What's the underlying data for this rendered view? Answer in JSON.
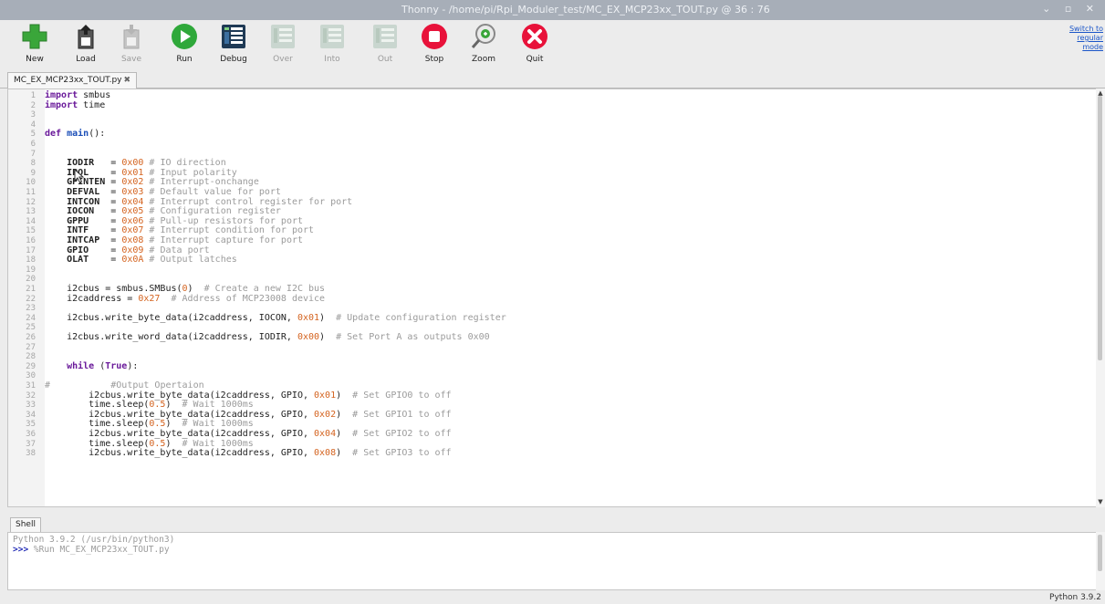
{
  "window": {
    "title": "Thonny  -  /home/pi/Rpi_Moduler_test/MC_EX_MCP23xx_TOUT.py  @  36 : 76",
    "controls": "⌄ ▫ ✕"
  },
  "toolbar": {
    "buttons": [
      {
        "label": "New",
        "icon": "new-icon",
        "enabled": true
      },
      {
        "label": "Load",
        "icon": "load-icon",
        "enabled": true
      },
      {
        "label": "Save",
        "icon": "save-icon",
        "enabled": false
      },
      {
        "label": "Run",
        "icon": "run-icon",
        "enabled": true
      },
      {
        "label": "Debug",
        "icon": "debug-icon",
        "enabled": true
      },
      {
        "label": "Over",
        "icon": "step-over-icon",
        "enabled": false
      },
      {
        "label": "Into",
        "icon": "step-into-icon",
        "enabled": false
      },
      {
        "label": "Out",
        "icon": "step-out-icon",
        "enabled": false
      },
      {
        "label": "Stop",
        "icon": "stop-icon",
        "enabled": true
      },
      {
        "label": "Zoom",
        "icon": "zoom-icon",
        "enabled": true
      },
      {
        "label": "Quit",
        "icon": "quit-icon",
        "enabled": true
      }
    ],
    "switch_mode": {
      "line1": "Switch to",
      "line2": "regular",
      "line3": "mode"
    }
  },
  "editor": {
    "tab_label": "MC_EX_MCP23xx_TOUT.py",
    "tab_close": "✖",
    "line_numbers": [
      "1",
      "2",
      "3",
      "4",
      "5",
      "6",
      "7",
      "8",
      "9",
      "10",
      "11",
      "12",
      "13",
      "14",
      "15",
      "16",
      "17",
      "18",
      "19",
      "20",
      "21",
      "22",
      "23",
      "24",
      "25",
      "26",
      "27",
      "28",
      "29",
      "30",
      "31",
      "32",
      "33",
      "34",
      "35",
      "36",
      "37",
      "38"
    ],
    "lines": [
      [
        [
          "kw",
          "import"
        ],
        [
          "p",
          " smbus"
        ]
      ],
      [
        [
          "kw",
          "import"
        ],
        [
          "p",
          " time"
        ]
      ],
      [],
      [],
      [
        [
          "kw",
          "def"
        ],
        [
          "p",
          " "
        ],
        [
          "fn",
          "main"
        ],
        [
          "p",
          "():"
        ]
      ],
      [],
      [],
      [
        [
          "p",
          "    "
        ],
        [
          "bd",
          "IODIR"
        ],
        [
          "p",
          "   = "
        ],
        [
          "nm",
          "0x00"
        ],
        [
          "cm",
          " # IO direction"
        ]
      ],
      [
        [
          "p",
          "    "
        ],
        [
          "bd",
          "IPOL"
        ],
        [
          "p",
          "    = "
        ],
        [
          "nm",
          "0x01"
        ],
        [
          "cm",
          " # Input polarity"
        ]
      ],
      [
        [
          "p",
          "    "
        ],
        [
          "bd",
          "GPINTEN"
        ],
        [
          "p",
          " = "
        ],
        [
          "nm",
          "0x02"
        ],
        [
          "cm",
          " # Interrupt-onchange"
        ]
      ],
      [
        [
          "p",
          "    "
        ],
        [
          "bd",
          "DEFVAL"
        ],
        [
          "p",
          "  = "
        ],
        [
          "nm",
          "0x03"
        ],
        [
          "cm",
          " # Default value for port"
        ]
      ],
      [
        [
          "p",
          "    "
        ],
        [
          "bd",
          "INTCON"
        ],
        [
          "p",
          "  = "
        ],
        [
          "nm",
          "0x04"
        ],
        [
          "cm",
          " # Interrupt control register for port"
        ]
      ],
      [
        [
          "p",
          "    "
        ],
        [
          "bd",
          "IOCON"
        ],
        [
          "p",
          "   = "
        ],
        [
          "nm",
          "0x05"
        ],
        [
          "cm",
          " # Configuration register"
        ]
      ],
      [
        [
          "p",
          "    "
        ],
        [
          "bd",
          "GPPU"
        ],
        [
          "p",
          "    = "
        ],
        [
          "nm",
          "0x06"
        ],
        [
          "cm",
          " # Pull-up resistors for port"
        ]
      ],
      [
        [
          "p",
          "    "
        ],
        [
          "bd",
          "INTF"
        ],
        [
          "p",
          "    = "
        ],
        [
          "nm",
          "0x07"
        ],
        [
          "cm",
          " # Interrupt condition for port"
        ]
      ],
      [
        [
          "p",
          "    "
        ],
        [
          "bd",
          "INTCAP"
        ],
        [
          "p",
          "  = "
        ],
        [
          "nm",
          "0x08"
        ],
        [
          "cm",
          " # Interrupt capture for port"
        ]
      ],
      [
        [
          "p",
          "    "
        ],
        [
          "bd",
          "GPIO"
        ],
        [
          "p",
          "    = "
        ],
        [
          "nm",
          "0x09"
        ],
        [
          "cm",
          " # Data port"
        ]
      ],
      [
        [
          "p",
          "    "
        ],
        [
          "bd",
          "OLAT"
        ],
        [
          "p",
          "    = "
        ],
        [
          "nm",
          "0x0A"
        ],
        [
          "cm",
          " # Output latches"
        ]
      ],
      [],
      [],
      [
        [
          "p",
          "    i2cbus = smbus.SMBus("
        ],
        [
          "nm",
          "0"
        ],
        [
          "p",
          ")  "
        ],
        [
          "cm",
          "# Create a new I2C bus"
        ]
      ],
      [
        [
          "p",
          "    i2caddress = "
        ],
        [
          "nm",
          "0x27"
        ],
        [
          "p",
          "  "
        ],
        [
          "cm",
          "# Address of MCP23008 device"
        ]
      ],
      [],
      [
        [
          "p",
          "    i2cbus.write_byte_data(i2caddress, IOCON, "
        ],
        [
          "nm",
          "0x01"
        ],
        [
          "p",
          ")  "
        ],
        [
          "cm",
          "# Update configuration register"
        ]
      ],
      [],
      [
        [
          "p",
          "    i2cbus.write_word_data(i2caddress, IODIR, "
        ],
        [
          "nm",
          "0x00"
        ],
        [
          "p",
          ")  "
        ],
        [
          "cm",
          "# Set Port A as outputs 0x00"
        ]
      ],
      [],
      [],
      [
        [
          "p",
          "    "
        ],
        [
          "kw",
          "while"
        ],
        [
          "p",
          " ("
        ],
        [
          "kw",
          "True"
        ],
        [
          "p",
          "):"
        ]
      ],
      [],
      [
        [
          "cm",
          "#"
        ],
        [
          "p",
          "           "
        ],
        [
          "cm",
          "#Output Opertaion"
        ]
      ],
      [
        [
          "p",
          "        i2cbus.write_byte_data(i2caddress, GPIO, "
        ],
        [
          "nm",
          "0x01"
        ],
        [
          "p",
          ")  "
        ],
        [
          "cm",
          "# Set GPIO0 to off"
        ]
      ],
      [
        [
          "p",
          "        time.sleep("
        ],
        [
          "nm",
          "0.5"
        ],
        [
          "p",
          ")  "
        ],
        [
          "cm",
          "# Wait 1000ms"
        ]
      ],
      [
        [
          "p",
          "        i2cbus.write_byte_data(i2caddress, GPIO, "
        ],
        [
          "nm",
          "0x02"
        ],
        [
          "p",
          ")  "
        ],
        [
          "cm",
          "# Set GPIO1 to off"
        ]
      ],
      [
        [
          "p",
          "        time.sleep("
        ],
        [
          "nm",
          "0.5"
        ],
        [
          "p",
          ")  "
        ],
        [
          "cm",
          "# Wait 1000ms"
        ]
      ],
      [
        [
          "p",
          "        i2cbus.write_byte_data(i2caddress, GPIO, "
        ],
        [
          "nm",
          "0x04"
        ],
        [
          "p",
          ")  "
        ],
        [
          "cm",
          "# Set GPIO2 to off"
        ]
      ],
      [
        [
          "p",
          "        time.sleep("
        ],
        [
          "nm",
          "0.5"
        ],
        [
          "p",
          ")  "
        ],
        [
          "cm",
          "# Wait 1000ms"
        ]
      ],
      [
        [
          "p",
          "        i2cbus.write_byte_data(i2caddress, GPIO, "
        ],
        [
          "nm",
          "0x08"
        ],
        [
          "p",
          ")  "
        ],
        [
          "cm",
          "# Set GPIO3 to off"
        ]
      ]
    ]
  },
  "shell": {
    "tab_label": "Shell",
    "line1": "Python 3.9.2 (/usr/bin/python3)",
    "prompt": ">>>",
    "command": " %Run MC_EX_MCP23xx_TOUT.py"
  },
  "status": {
    "interpreter": "Python 3.9.2"
  },
  "colors": {
    "keyword": "#6a1a9a",
    "number": "#d4631f",
    "comment": "#9b9b9b",
    "function": "#1c4fb8",
    "run_green": "#2fa83a",
    "stop_red": "#e8123a"
  }
}
